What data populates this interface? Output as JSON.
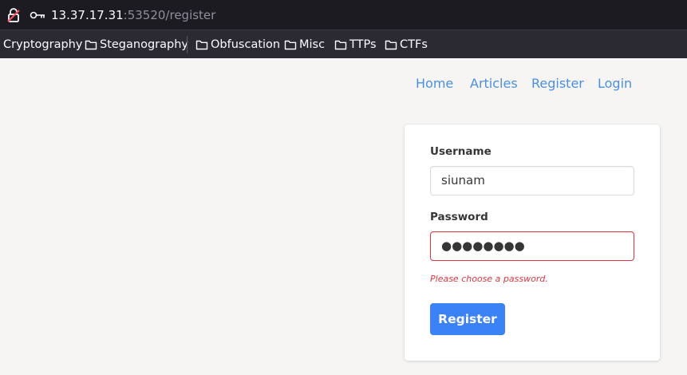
{
  "browser": {
    "url_host": "13.37.17.31",
    "url_rest": ":53520/register",
    "bookmarks": [
      "Cryptography",
      "Steganography",
      "Obfuscation",
      "Misc",
      "TTPs",
      "CTFs"
    ]
  },
  "nav": {
    "items": [
      "Home",
      "Articles",
      "Register",
      "Login"
    ],
    "link_color": "#4a90e2"
  },
  "form": {
    "username_label": "Username",
    "username_value": "siunam",
    "password_label": "Password",
    "password_value": "●●●●●●●●",
    "password_error": "Please choose a password.",
    "submit_label": "Register",
    "danger_color": "#e0363f",
    "button_color": "#3b82f6"
  }
}
